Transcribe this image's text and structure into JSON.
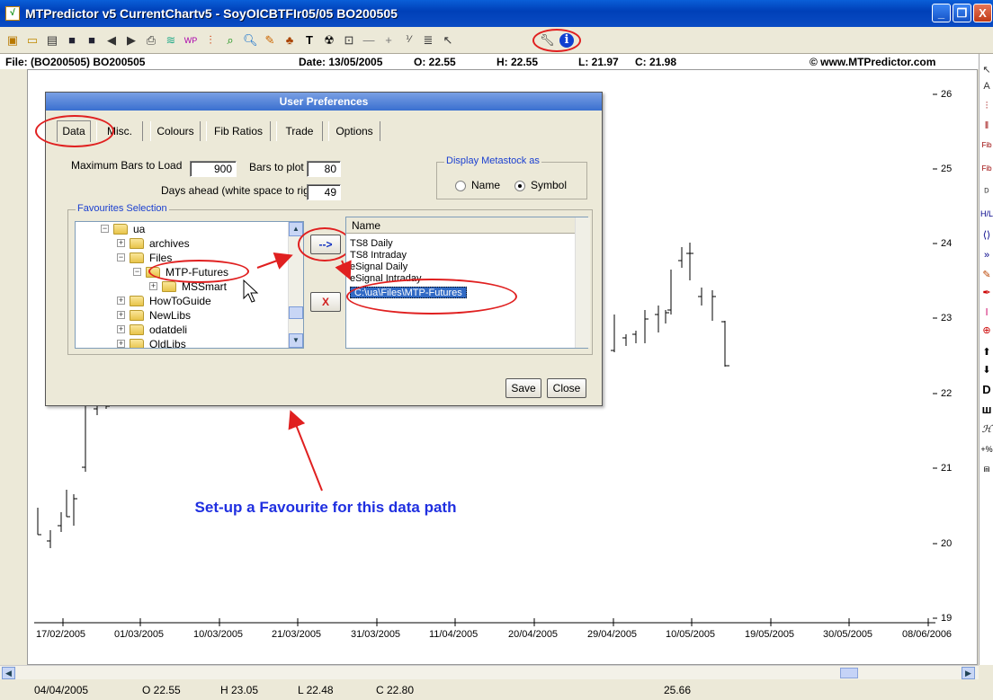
{
  "window": {
    "title": "MTPredictor v5 CurrentChartv5 - SoyOICBTFIr05/05 BO200505",
    "icon": "mtp-app-icon"
  },
  "window_controls": {
    "minimize": "_",
    "restore": "❐",
    "close": "X"
  },
  "toolbar": {
    "icons": [
      "open-icon",
      "folder-icon",
      "print-setup-icon",
      "save-icon",
      "save-as-icon",
      "back-icon",
      "forward-icon",
      "print-icon",
      "chart-icon",
      "wp-icon",
      "bars-icon",
      "zoom-fit-icon",
      "zoom-icon",
      "pen-icon",
      "tree-icon",
      "text-icon",
      "radiation-icon",
      "zoom-box-icon",
      "line-icon",
      "crosshair-icon",
      "fraction-icon",
      "list-icon",
      "cursor-icon",
      "preferences-icon",
      "info-icon"
    ]
  },
  "info": {
    "file": "File: (BO200505) BO200505",
    "date": "Date: 13/05/2005",
    "open": "O: 22.55",
    "high": "H: 22.55",
    "low": "L: 21.97",
    "close": "C: 21.98",
    "copyright": "© www.MTPredictor.com"
  },
  "y_axis": [
    "26",
    "25",
    "24",
    "23",
    "22",
    "21",
    "20",
    "19"
  ],
  "x_axis": [
    "17/02/2005",
    "01/03/2005",
    "10/03/2005",
    "21/03/2005",
    "31/03/2005",
    "11/04/2005",
    "20/04/2005",
    "29/04/2005",
    "10/05/2005",
    "19/05/2005",
    "30/05/2005",
    "08/06/2006"
  ],
  "status": {
    "date": "04/04/2005",
    "open": "O 22.55",
    "high": "H 23.05",
    "low": "L 22.48",
    "close": "C 22.80",
    "price": "25.66"
  },
  "dialog": {
    "title": "User Preferences",
    "tabs": [
      "Data",
      "Misc.",
      "Colours",
      "Fib Ratios",
      "Trade",
      "Options"
    ],
    "max_bars_label": "Maximum Bars to Load",
    "max_bars_value": "900",
    "bars_plot_label": "Bars to plot",
    "bars_plot_value": "80",
    "days_ahead_label": "Days ahead (white space to right)",
    "days_ahead_value": "49",
    "metastock_group": "Display Metastock as",
    "radio_name": "Name",
    "radio_symbol": "Symbol",
    "selected_radio": "Symbol",
    "favourites_group": "Favourites Selection",
    "tree": [
      "ua",
      "archives",
      "Files",
      "MTP-Futures",
      "MSSmart",
      "HowToGuide",
      "NewLibs",
      "odatdeli",
      "OldLibs"
    ],
    "add_button": "-->",
    "remove_button": "X",
    "list_header": "Name",
    "list_items": [
      "TS8 Daily",
      "TS8 Intraday",
      "eSignal Daily",
      "eSignal Intraday"
    ],
    "list_selected": "C:\\ua\\Files\\MTP-Futures",
    "save": "Save",
    "close": "Close"
  },
  "annotation": "Set-up a Favourite for this data path",
  "colors": {
    "annotation": "#1f2fe0",
    "highlight_ring": "#e02020",
    "titlebar": "#0a4cc4"
  }
}
